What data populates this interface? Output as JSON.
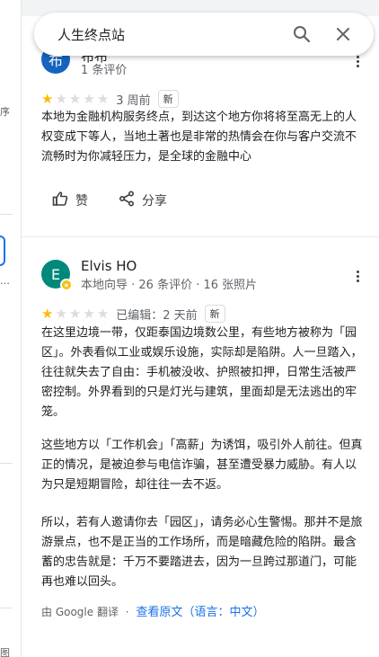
{
  "left_strip": {
    "frags": [
      "序",
      "…",
      "…",
      "图"
    ]
  },
  "search": {
    "query": "人生终点站",
    "search_icon": "search-icon",
    "close_icon": "close-icon"
  },
  "review1": {
    "avatar_letter": "布",
    "avatar_color": "#1565c0",
    "name": "布布",
    "stats": "1 条评价",
    "rating": 1,
    "max_rating": 5,
    "time": "3 周前",
    "badge": "新",
    "text": "本地为金融机构服务终点，到达这个地方你将将至高无上的人权变成下等人，当地土著也是非常的热情会在你与客户交流不流畅时为你减轻压力，是全球的金融中心",
    "like_label": "赞",
    "share_label": "分享"
  },
  "review2": {
    "avatar_letter": "E",
    "avatar_color": "#00897b",
    "name": "Elvis HO",
    "stats": "本地向导 · 26 条评价 · 16 张照片",
    "rating": 1,
    "max_rating": 5,
    "time": "已编辑：2 天前",
    "badge": "新",
    "paragraphs": [
      "在这里边境一带，仅距泰国边境数公里，有些地方被称为「园区」。外表看似工业或娱乐设施，实际却是陷阱。人一旦踏入，往往就失去了自由：手机被没收、护照被扣押，日常生活被严密控制。外界看到的只是灯光与建筑，里面却是无法逃出的牢笼。",
      "这些地方以「工作机会」「高薪」为诱饵，吸引外人前往。但真正的情况，是被迫参与电信诈骗，甚至遭受暴力威胁。有人以为只是短期冒险，却往往一去不返。",
      "所以，若有人邀请你去「园区」，请务必心生警惕。那并不是旅游景点，也不是正当的工作场所，而是暗藏危险的陷阱。最含蓄的忠告就是：千万不要踏进去，因为一旦跨过那道门，可能再也难以回头。"
    ],
    "translated_by": "由 Google 翻译",
    "view_original": "查看原文（语言：中文）"
  },
  "colors": {
    "star_on": "#fbbc04",
    "star_off": "#dadce0",
    "link": "#1a73e8"
  }
}
